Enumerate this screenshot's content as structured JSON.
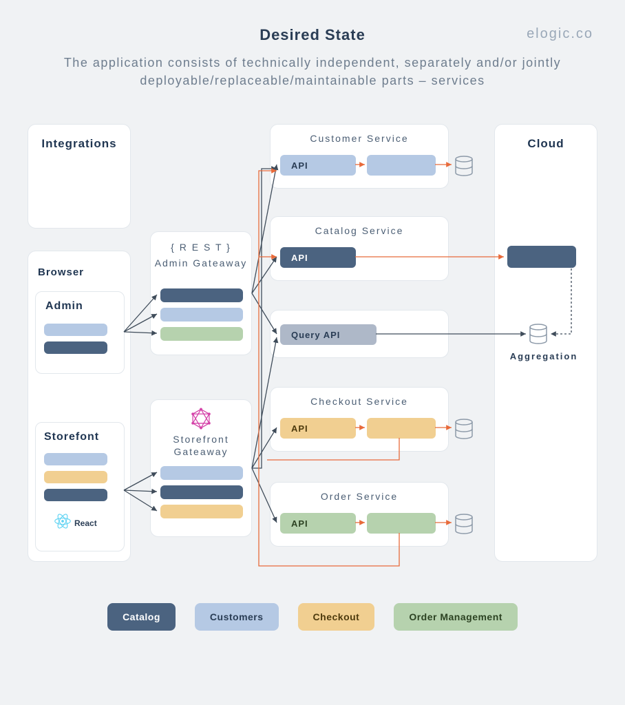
{
  "header": {
    "title": "Desired State",
    "brand": "elogic.co",
    "subtitle": "The application consists of technically independent, separately and/or jointly deployable/replaceable/maintainable parts – services"
  },
  "blocks": {
    "integrations": "Integrations",
    "browser": "Browser",
    "admin": "Admin",
    "storefront": "Storefont",
    "react": "React",
    "adminGateway": {
      "rest": "{ R E S T }",
      "title": "Admin Gateaway"
    },
    "storefrontGateway": {
      "title": "Storefront Gateaway"
    },
    "cloud": "Cloud",
    "aggregation": "Aggregation"
  },
  "services": {
    "customer": {
      "title": "Customer Service",
      "api": "API"
    },
    "catalog": {
      "title": "Catalog Service",
      "api": "API"
    },
    "query": {
      "api": "Query API"
    },
    "checkout": {
      "title": "Checkout Service",
      "api": "API"
    },
    "order": {
      "title": "Order Service",
      "api": "API"
    }
  },
  "legend": {
    "catalog": "Catalog",
    "customers": "Customers",
    "checkout": "Checkout",
    "order": "Order Management"
  },
  "colors": {
    "catalog": "#4b6380",
    "customers": "#b5c9e4",
    "checkout": "#f1cf91",
    "order": "#b6d2ae",
    "arrow_dark": "#3f4c5a",
    "arrow_orange": "#e86a3a"
  }
}
